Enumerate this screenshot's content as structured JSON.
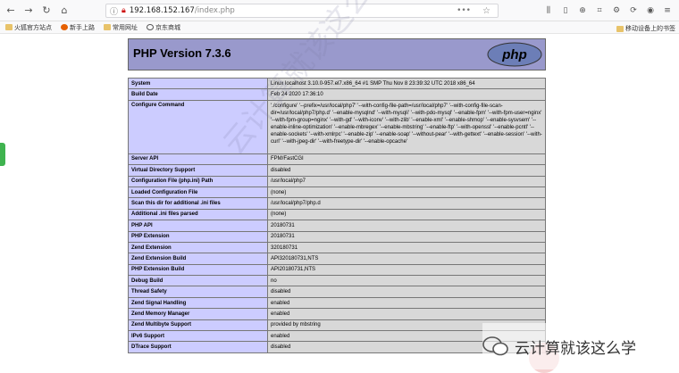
{
  "browser": {
    "url_host": "192.168.152.167",
    "url_path": "/index.php",
    "bookmarks": [
      "火狐官方站点",
      "新手上路",
      "常用网址",
      "京东商城"
    ],
    "mobile_bookmarks": "移动设备上的书签"
  },
  "php": {
    "title": "PHP Version 7.3.6",
    "logo_text": "php",
    "rows": [
      {
        "key": "System",
        "value": "Linux localhost 3.10.0-957.el7.x86_64 #1 SMP Thu Nov 8 23:39:32 UTC 2018 x86_64"
      },
      {
        "key": "Build Date",
        "value": "Feb 24 2020 17:36:10"
      },
      {
        "key": "Configure Command",
        "value": "'./configure' '--prefix=/usr/local/php7' '--with-config-file-path=/usr/local/php7' '--with-config-file-scan-dir=/usr/local/php7/php.d' '--enable-mysqlnd' '--with-mysqli' '--with-pdo-mysql' '--enable-fpm' '--with-fpm-user=nginx' '--with-fpm-group=nginx' '--with-gd' '--with-iconv' '--with-zlib' '--enable-xml' '--enable-shmop' '--enable-sysvsem' '--enable-inline-optimization' '--enable-mbregex' '--enable-mbstring' '--enable-ftp' '--with-openssl' '--enable-pcntl' '--enable-sockets' '--with-xmlrpc' '--enable-zip' '--enable-soap' '--without-pear' '--with-gettext' '--enable-session' '--with-curl' '--with-jpeg-dir' '--with-freetype-dir' '--enable-opcache'"
      },
      {
        "key": "Server API",
        "value": "FPM/FastCGI"
      },
      {
        "key": "Virtual Directory Support",
        "value": "disabled"
      },
      {
        "key": "Configuration File (php.ini) Path",
        "value": "/usr/local/php7"
      },
      {
        "key": "Loaded Configuration File",
        "value": "(none)"
      },
      {
        "key": "Scan this dir for additional .ini files",
        "value": "/usr/local/php7/php.d"
      },
      {
        "key": "Additional .ini files parsed",
        "value": "(none)"
      },
      {
        "key": "PHP API",
        "value": "20180731"
      },
      {
        "key": "PHP Extension",
        "value": "20180731"
      },
      {
        "key": "Zend Extension",
        "value": "320180731"
      },
      {
        "key": "Zend Extension Build",
        "value": "API320180731,NTS"
      },
      {
        "key": "PHP Extension Build",
        "value": "API20180731,NTS"
      },
      {
        "key": "Debug Build",
        "value": "no"
      },
      {
        "key": "Thread Safety",
        "value": "disabled"
      },
      {
        "key": "Zend Signal Handling",
        "value": "enabled"
      },
      {
        "key": "Zend Memory Manager",
        "value": "enabled"
      },
      {
        "key": "Zend Multibyte Support",
        "value": "provided by mbstring"
      },
      {
        "key": "IPv6 Support",
        "value": "enabled"
      },
      {
        "key": "DTrace Support",
        "value": "disabled"
      }
    ]
  },
  "watermark": {
    "diagonal_text": "云计算就该这么学",
    "brand_text": "云计算就该这么学"
  },
  "colors": {
    "header_bg": "#9999cc",
    "key_bg": "#ccccff",
    "value_bg": "#d8d8d8"
  }
}
